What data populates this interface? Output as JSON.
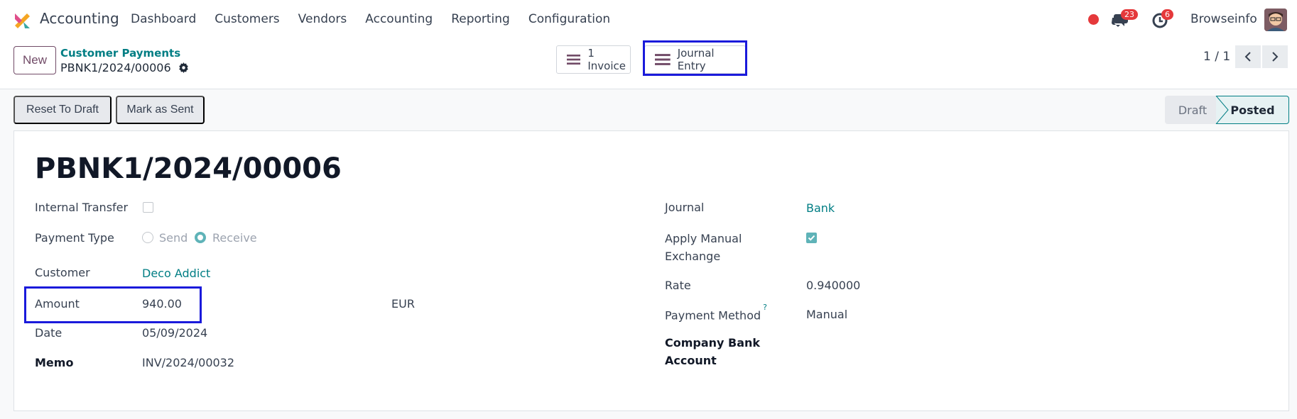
{
  "navbar": {
    "app_name": "Accounting",
    "menu": [
      "Dashboard",
      "Customers",
      "Vendors",
      "Accounting",
      "Reporting",
      "Configuration"
    ],
    "chat_count": "23",
    "activity_count": "6",
    "company": "Browseinfo"
  },
  "control": {
    "new_label": "New",
    "breadcrumb_parent": "Customer Payments",
    "breadcrumb_current": "PBNK1/2024/00006",
    "invoice_button": "1 Invoice",
    "journal_entry_button": "Journal Entry",
    "pager": "1 / 1"
  },
  "actions": {
    "reset_to_draft": "Reset To Draft",
    "mark_as_sent": "Mark as Sent"
  },
  "status": {
    "draft": "Draft",
    "posted": "Posted",
    "current": "Posted"
  },
  "form": {
    "title": "PBNK1/2024/00006",
    "internal_transfer_label": "Internal Transfer",
    "internal_transfer_checked": false,
    "payment_type_label": "Payment Type",
    "payment_type_options": [
      "Send",
      "Receive"
    ],
    "payment_type_selected": "Receive",
    "customer_label": "Customer",
    "customer_value": "Deco Addict",
    "amount_label": "Amount",
    "amount_value": "940.00",
    "currency": "EUR",
    "date_label": "Date",
    "date_value": "05/09/2024",
    "memo_label": "Memo",
    "memo_value": "INV/2024/00032",
    "journal_label": "Journal",
    "journal_value": "Bank",
    "apply_manual_exchange_label_1": "Apply Manual",
    "apply_manual_exchange_label_2": "Exchange",
    "apply_manual_exchange_checked": true,
    "rate_label": "Rate",
    "rate_value": "0.940000",
    "payment_method_label": "Payment Method",
    "payment_method_help": "?",
    "payment_method_value": "Manual",
    "company_bank_label_1": "Company Bank",
    "company_bank_label_2": "Account"
  },
  "colors": {
    "brand": "#714b67",
    "link": "#017e84",
    "badge": "#e5393b",
    "highlight": "#1a1adb"
  }
}
